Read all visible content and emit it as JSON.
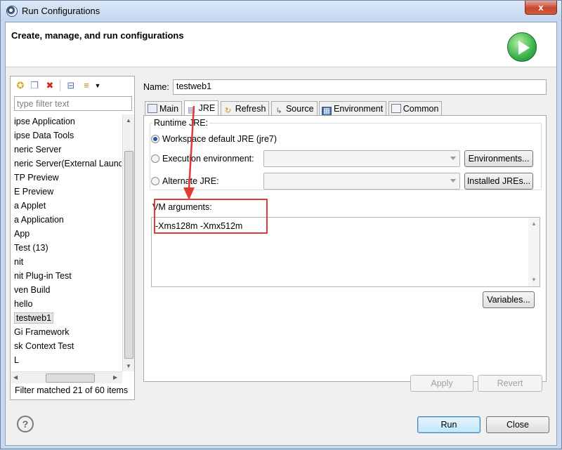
{
  "window": {
    "title": "Run Configurations",
    "close_label": "x"
  },
  "header": {
    "title": "Create, manage, and run configurations"
  },
  "left": {
    "filter_placeholder": "type filter text",
    "items": [
      "ipse Application",
      "ipse Data Tools",
      "neric Server",
      "neric Server(External Launc",
      "TP Preview",
      "E Preview",
      "a Applet",
      "a Application",
      "App",
      "Test (13)",
      "nit",
      "nit Plug-in Test",
      "ven Build",
      "hello",
      "testweb1",
      "Gi Framework",
      "sk Context Test",
      "L"
    ],
    "status": "Filter matched 21 of 60 items"
  },
  "right": {
    "name_label": "Name:",
    "name_value": "testweb1",
    "tabs": [
      "Main",
      "JRE",
      "Refresh",
      "Source",
      "Environment",
      "Common"
    ],
    "runtime_label": "Runtime JRE:",
    "workspace_label": "Workspace default JRE (jre7)",
    "exec_label": "Execution environment:",
    "alt_label": "Alternate JRE:",
    "environments_btn": "Environments...",
    "installed_btn": "Installed JREs...",
    "vm_label": "VM arguments:",
    "vm_value": "-Xms128m -Xmx512m",
    "variables_btn": "Variables...",
    "apply_btn": "Apply",
    "revert_btn": "Revert"
  },
  "footer": {
    "help": "?",
    "run_btn": "Run",
    "close_btn": "Close"
  },
  "colors": {
    "highlight": "#e53935"
  }
}
